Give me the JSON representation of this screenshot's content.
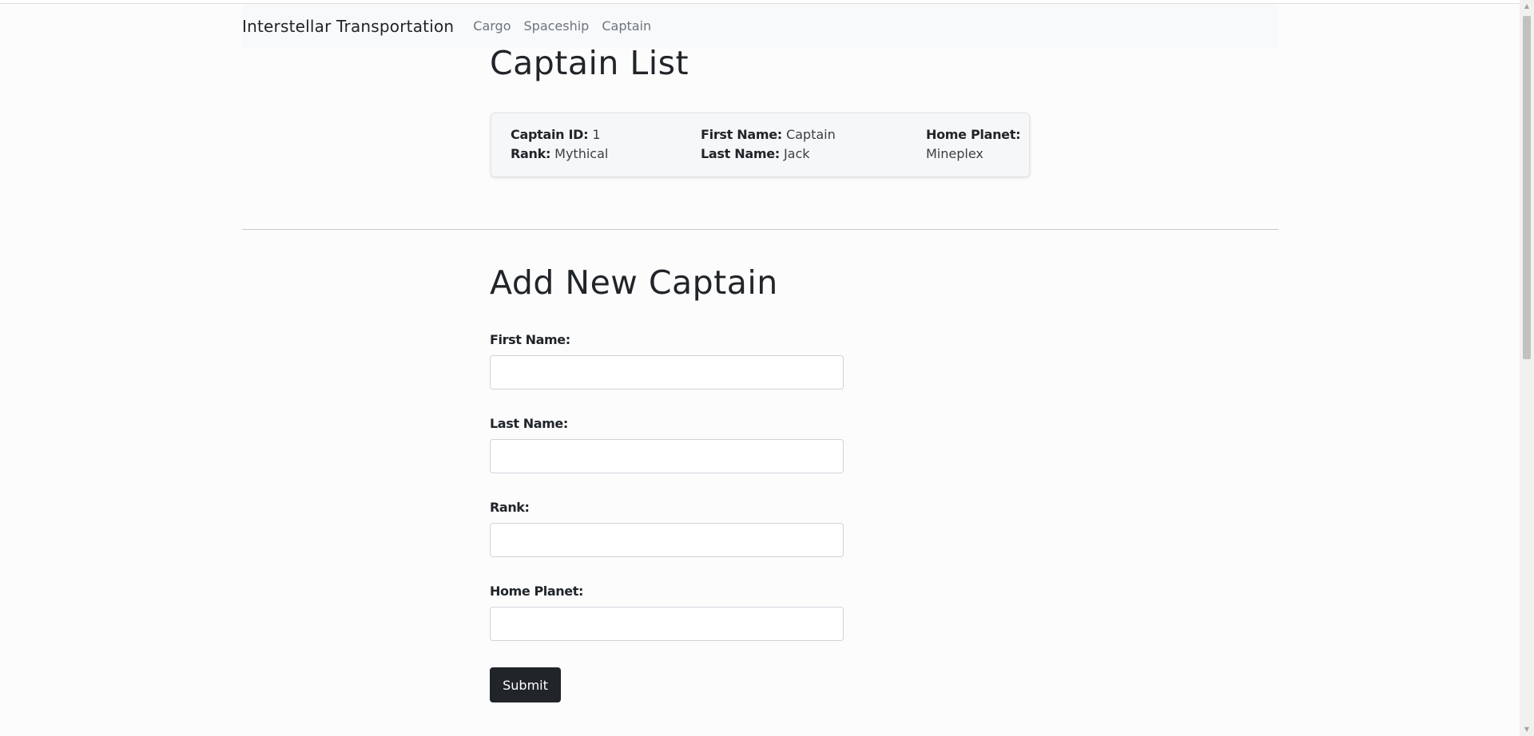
{
  "navbar": {
    "brand": "Interstellar Transportation",
    "links": [
      "Cargo",
      "Spaceship",
      "Captain"
    ]
  },
  "captain_list": {
    "title": "Captain List",
    "captains": [
      {
        "id_label": "Captain ID:",
        "id": "1",
        "rank_label": "Rank:",
        "rank": "Mythical",
        "first_name_label": "First Name:",
        "first_name": "Captain",
        "last_name_label": "Last Name:",
        "last_name": "Jack",
        "home_planet_label": "Home Planet:",
        "home_planet": "Mineplex"
      }
    ]
  },
  "form": {
    "title": "Add New Captain",
    "fields": [
      {
        "label": "First Name:",
        "value": ""
      },
      {
        "label": "Last Name:",
        "value": ""
      },
      {
        "label": "Rank:",
        "value": ""
      },
      {
        "label": "Home Planet:",
        "value": ""
      }
    ],
    "submit_label": "Submit"
  },
  "scrollbar": {
    "up_icon": "caret-up-icon",
    "down_icon": "caret-down-icon"
  }
}
